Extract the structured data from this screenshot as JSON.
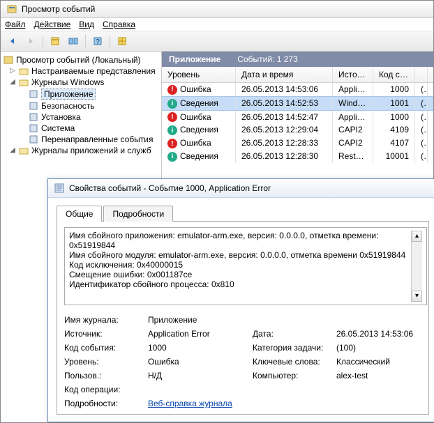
{
  "window": {
    "title": "Просмотр событий"
  },
  "menu": {
    "file": "Файл",
    "action": "Действие",
    "view": "Вид",
    "help": "Справка"
  },
  "tree": {
    "root": "Просмотр событий (Локальный)",
    "custom_views": "Настраиваемые представления",
    "win_logs": "Журналы Windows",
    "app": "Приложение",
    "security": "Безопасность",
    "setup": "Установка",
    "system": "Система",
    "forwarded": "Перенаправленные события",
    "app_services": "Журналы приложений и служб"
  },
  "right": {
    "header_title": "Приложение",
    "header_count": "Событий: 1 273",
    "cols": {
      "level": "Уровень",
      "datetime": "Дата и время",
      "source": "Источ...",
      "code": "Код со..."
    },
    "rows": [
      {
        "level": "Ошибка",
        "icon": "err",
        "dt": "26.05.2013 14:53:06",
        "src": "Applic...",
        "code": "1000",
        "extra": "("
      },
      {
        "level": "Сведения",
        "icon": "info",
        "dt": "26.05.2013 14:52:53",
        "src": "Windo...",
        "code": "1001",
        "extra": "("
      },
      {
        "level": "Ошибка",
        "icon": "err",
        "dt": "26.05.2013 14:52:47",
        "src": "Applic...",
        "code": "1000",
        "extra": "("
      },
      {
        "level": "Сведения",
        "icon": "info",
        "dt": "26.05.2013 12:29:04",
        "src": "CAPI2",
        "code": "4109",
        "extra": "("
      },
      {
        "level": "Ошибка",
        "icon": "err",
        "dt": "26.05.2013 12:28:33",
        "src": "CAPI2",
        "code": "4107",
        "extra": "("
      },
      {
        "level": "Сведения",
        "icon": "info",
        "dt": "26.05.2013 12:28:30",
        "src": "Restart...",
        "code": "10001",
        "extra": "("
      }
    ]
  },
  "dialog": {
    "title": "Свойства событий - Событие 1000, Application Error",
    "tabs": {
      "general": "Общие",
      "details": "Подробности"
    },
    "lines": {
      "l1": "Имя сбойного приложения: emulator-arm.exe, версия: 0.0.0.0, отметка времени:",
      "l2": "0x51919844",
      "l3": "Имя сбойного модуля: emulator-arm.exe, версия: 0.0.0.0, отметка времени 0x51919844",
      "l4": "Код исключения: 0x40000015",
      "l5": "Смещение ошибки: 0x001187ce",
      "l6": "Идентификатор сбойного процесса: 0x810"
    },
    "kv": {
      "logname_l": "Имя журнала:",
      "logname_v": "Приложение",
      "source_l": "Источник:",
      "source_v": "Application Error",
      "date_l": "Дата:",
      "date_v": "26.05.2013 14:53:06",
      "eventid_l": "Код события:",
      "eventid_v": "1000",
      "taskcat_l": "Категория задачи:",
      "taskcat_v": "(100)",
      "level_l": "Уровень:",
      "level_v": "Ошибка",
      "keywords_l": "Ключевые слова:",
      "keywords_v": "Классический",
      "user_l": "Пользов.:",
      "user_v": "Н/Д",
      "computer_l": "Компьютер:",
      "computer_v": "alex-test",
      "opcode_l": "Код операции:",
      "moreinfo_l": "Подробности:",
      "moreinfo_v": "Веб-справка журнала"
    }
  }
}
